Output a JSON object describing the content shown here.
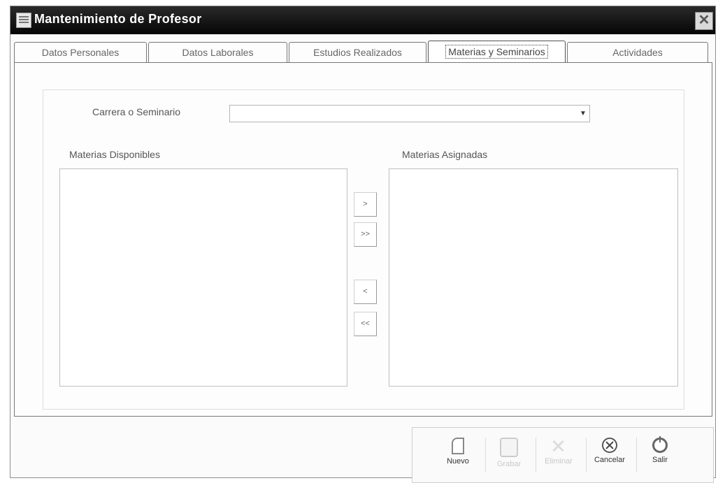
{
  "window": {
    "title": "Mantenimiento de Profesor",
    "close_symbol": "✕"
  },
  "tabs": [
    {
      "label": "Datos Personales",
      "active": false
    },
    {
      "label": "Datos Laborales",
      "active": false
    },
    {
      "label": "Estudios Realizados",
      "active": false
    },
    {
      "label": "Materias y Seminarios",
      "active": true
    },
    {
      "label": "Actividades",
      "active": false
    }
  ],
  "form": {
    "carrera_label": "Carrera o Seminario",
    "carrera_value": "",
    "available_label": "Materias Disponibles",
    "assigned_label": "Materias Asignadas",
    "available_items": [],
    "assigned_items": []
  },
  "move_buttons": {
    "add_one": ">",
    "add_all": ">>",
    "remove_one": "<",
    "remove_all": "<<"
  },
  "toolbar": {
    "nuevo": "Nuevo",
    "grabar": "Grabar",
    "eliminar": "Eliminar",
    "cancelar": "Cancelar",
    "salir": "Salir"
  },
  "icons": {
    "window": "window-icon",
    "nuevo": "new-document-icon",
    "grabar": "save-icon",
    "eliminar": "delete-icon",
    "cancelar": "cancel-icon",
    "salir": "exit-icon"
  }
}
